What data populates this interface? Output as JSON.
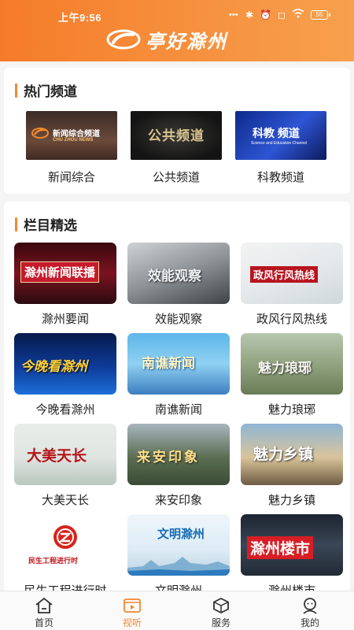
{
  "status_bar": {
    "time": "上午9:56",
    "dots": "•••",
    "battery": "55"
  },
  "header": {
    "app_name": "亭好滁州"
  },
  "hot_channels": {
    "title": "热门频道",
    "items": [
      {
        "label": "新闻综合",
        "thumb_text": "新闻综合频道",
        "thumb_sub": "CHU ZHOU NEWS"
      },
      {
        "label": "公共频道",
        "thumb_text": "公共频道"
      },
      {
        "label": "科教频道",
        "thumb_text": "科教 频道",
        "thumb_sub": "Science and Education Channel"
      }
    ]
  },
  "featured": {
    "title": "栏目精选",
    "items": [
      {
        "label": "滁州要闻",
        "thumb_text": "滁州新闻联播"
      },
      {
        "label": "效能观察",
        "thumb_text": "效能观察"
      },
      {
        "label": "政风行风热线",
        "thumb_text": "政风行风热线"
      },
      {
        "label": "今晚看滁州",
        "thumb_text": "今晚看滁州"
      },
      {
        "label": "南谯新闻",
        "thumb_text": "南谯新闻"
      },
      {
        "label": "魅力琅琊",
        "thumb_text": "魅力琅琊"
      },
      {
        "label": "大美天长",
        "thumb_text": "大美天长"
      },
      {
        "label": "来安印象",
        "thumb_text": "来安印象"
      },
      {
        "label": "魅力乡镇",
        "thumb_text": "魅力乡镇"
      },
      {
        "label": "民生工程进行时",
        "thumb_text": "民生工程进行时"
      },
      {
        "label": "文明滁州",
        "thumb_text": "文明滁州"
      },
      {
        "label": "滁州楼市",
        "thumb_text": "滁州楼市"
      }
    ]
  },
  "tabbar": {
    "items": [
      {
        "label": "首页",
        "icon": "home-icon"
      },
      {
        "label": "视听",
        "icon": "video-icon"
      },
      {
        "label": "服务",
        "icon": "cube-icon"
      },
      {
        "label": "我的",
        "icon": "user-icon"
      }
    ],
    "active_index": 1
  },
  "colors": {
    "accent": "#f5862f",
    "header_start": "#f57b2a",
    "header_end": "#f7a04d"
  }
}
